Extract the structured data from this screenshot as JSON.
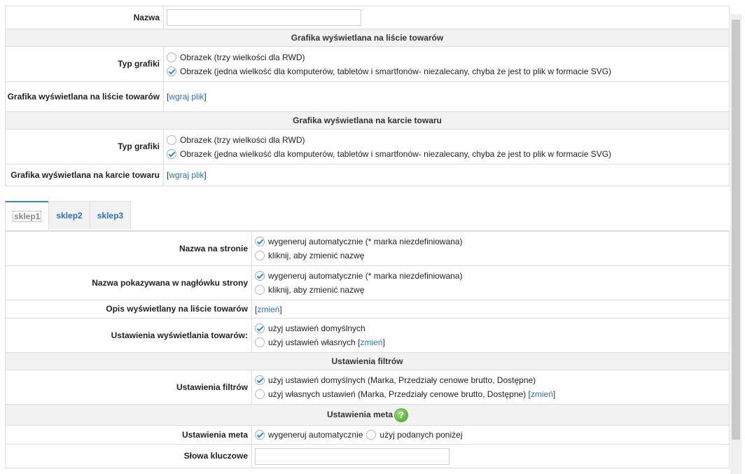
{
  "top": {
    "name_label": "Nazwa",
    "name_value": "",
    "list_section": "Grafika wyświetlana na liście towarów",
    "list_type_label": "Typ grafiki",
    "list_opt1": "Obrazek (trzy wielkości dla RWD)",
    "list_opt2": "Obrazek (jedna wielkość dla komputerów, tabletów i smartfonów- niezalecany, chyba że jest to plik w formacie SVG)",
    "list_graphic_label": "Grafika wyświetlana na liście towarów",
    "upload_link": "wgraj plik",
    "card_section": "Grafika wyświetlana na karcie towaru",
    "card_type_label": "Typ grafiki",
    "card_opt1": "Obrazek (trzy wielkości dla RWD)",
    "card_opt2": "Obrazek (jedna wielkość dla komputerów, tabletów i smartfonów- niezalecany, chyba że jest to plik w formacie SVG)",
    "card_graphic_label": "Grafika wyświetlana na karcie towaru",
    "card_upload_link": "wgraj plik"
  },
  "tabs": [
    "sklep1",
    "sklep2",
    "sklep3"
  ],
  "active_tab": "sklep1",
  "shop": {
    "page_name_label": "Nazwa na stronie",
    "auto_generate": "wygeneruj automatycznie (* marka niezdefiniowana)",
    "click_change": "kliknij, aby zmienić nazwę",
    "header_name_label": "Nazwa pokazywana w nagłówku strony",
    "auto_generate2": "wygeneruj automatycznie (* marka niezdefiniowana)",
    "click_change2": "kliknij, aby zmienić nazwę",
    "list_desc_label": "Opis wyświetlany na liście towarów",
    "change_link": "zmień",
    "display_settings_label": "Ustawienia wyświetlania towarów:",
    "use_default": "użyj ustawień domyślnych",
    "use_own": "użyj ustawień własnych",
    "change_link2": "zmień",
    "filters_section": "Ustawienia filtrów",
    "filters_label": "Ustawienia filtrów",
    "filters_default": "użyj ustawień domyślnych (Marka, Przedziały cenowe brutto, Dostępne)",
    "filters_own": "użyj własnych ustawień (Marka, Przedziały cenowe brutto, Dostępne)",
    "change_link3": "zmień",
    "meta_section": "Ustawienia meta",
    "meta_label": "Ustawienia meta",
    "meta_auto": "wygeneruj automatycznie",
    "meta_given": "użyj podanych poniżej",
    "keywords_label": "Słowa kluczowe",
    "keywords_value": ""
  },
  "colors": {
    "link": "#2a72b8",
    "section_bg": "#f2f2f2",
    "border": "#dcdcdc",
    "help_icon": "#3f9f25"
  },
  "icons": {
    "help": "help-icon",
    "check": "radio-checked-icon"
  }
}
